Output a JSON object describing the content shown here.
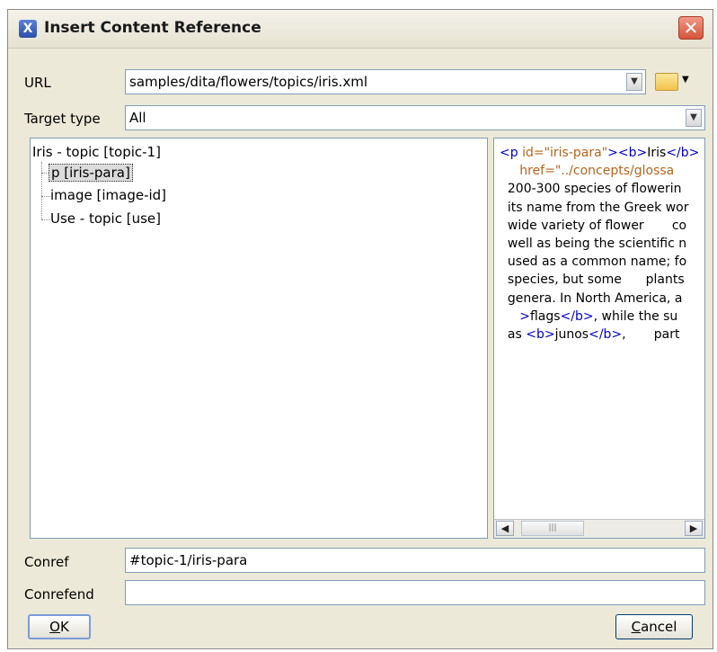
{
  "window": {
    "title": "Insert Content Reference",
    "close_glyph": "✕"
  },
  "url": {
    "label": "URL",
    "value": "samples/dita/flowers/topics/iris.xml"
  },
  "target_type": {
    "label": "Target type",
    "value": "All"
  },
  "tree": {
    "root": "Iris - topic [topic-1]",
    "children": [
      "p [iris-para]",
      "image [image-id]",
      "Use - topic [use]"
    ],
    "selected_index": 0
  },
  "preview": {
    "lines": [
      [
        {
          "t": "<p ",
          "c": "tag"
        },
        {
          "t": "id=\"iris-para\"",
          "c": "attr"
        },
        {
          "t": "><b>",
          "c": "tag"
        },
        {
          "t": "Iris",
          "c": "txt"
        },
        {
          "t": "</b>",
          "c": "tag"
        }
      ],
      [
        {
          "t": "     href=\"../concepts/glossa",
          "c": "attr"
        }
      ],
      [
        {
          "t": "  200-300 species of flowerin",
          "c": "txt"
        }
      ],
      [
        {
          "t": "  its name from the Greek wor",
          "c": "txt"
        }
      ],
      [
        {
          "t": "  wide variety of flower       co",
          "c": "txt"
        }
      ],
      [
        {
          "t": "  well as being the scientific n",
          "c": "txt"
        }
      ],
      [
        {
          "t": "  used as a common name; fo",
          "c": "txt"
        }
      ],
      [
        {
          "t": "  species, but some      plants",
          "c": "txt"
        }
      ],
      [
        {
          "t": "  genera. In North America, a",
          "c": "txt"
        }
      ],
      [
        {
          "t": "     >",
          "c": "tag"
        },
        {
          "t": "flags",
          "c": "txt"
        },
        {
          "t": "</b>",
          "c": "tag"
        },
        {
          "t": ", while the su",
          "c": "txt"
        }
      ],
      [
        {
          "t": "  as ",
          "c": "txt"
        },
        {
          "t": "<b>",
          "c": "tag"
        },
        {
          "t": "junos",
          "c": "txt"
        },
        {
          "t": "</b>",
          "c": "tag"
        },
        {
          "t": ",       part",
          "c": "txt"
        }
      ]
    ]
  },
  "conref": {
    "label": "Conref",
    "value": "#topic-1/iris-para"
  },
  "conrefend": {
    "label": "Conrefend",
    "value": ""
  },
  "buttons": {
    "ok_underlined": "O",
    "ok_rest": "K",
    "cancel_underlined": "C",
    "cancel_rest": "ancel"
  },
  "icons": {
    "app": "oxygen-app-icon",
    "dropdown": "chevron-down-icon",
    "folder": "folder-open-icon",
    "scroll_left": "◀",
    "scroll_right": "▶",
    "thumb_grip": "|||"
  },
  "colors": {
    "tag": "#0000c8",
    "attr": "#b5651d",
    "close": "#d4543a"
  }
}
